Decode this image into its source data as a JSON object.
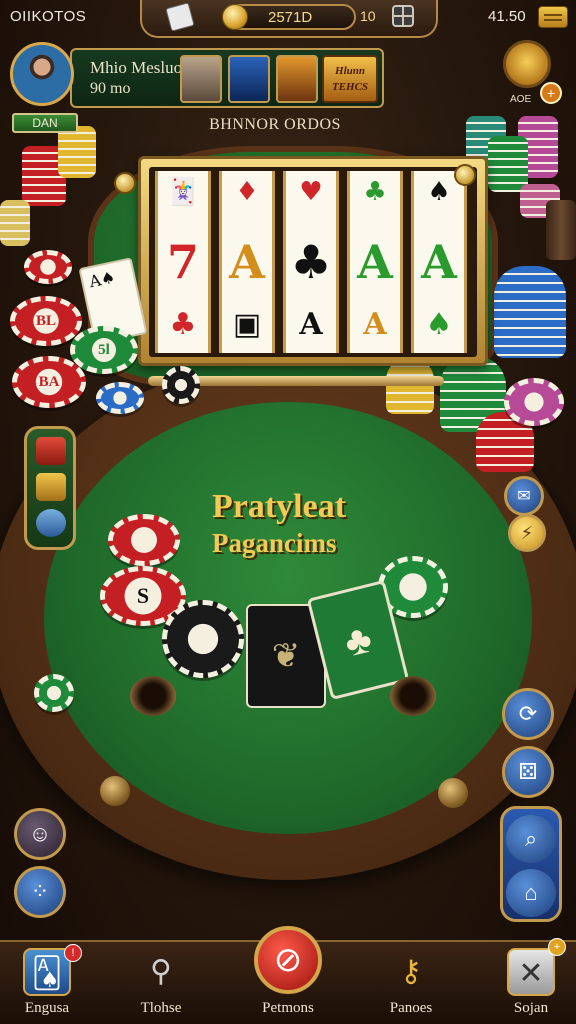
{
  "top_bar": {
    "left_label": "OIIKOTOS",
    "coin_balance": "2571D",
    "level": "10",
    "right_value": "41.50"
  },
  "profile": {
    "name": "Mhio Mesluo",
    "level": "90 mo",
    "status_tag": "DAN",
    "promo_text": "Hlunn TEHCS"
  },
  "table": {
    "title": "BHNNOR ORDOS",
    "felt_title_line1": "Pratyleat",
    "felt_title_line2": "Pagancims"
  },
  "bonus": {
    "label": "AOE",
    "badge": "+"
  },
  "chips": {
    "left_top": "BL",
    "left_green": "5l",
    "left_bottom": "BA",
    "felt_white": "S"
  },
  "slot_machine": {
    "reels": [
      {
        "top": "🃏",
        "mid": "7",
        "bot": "♣"
      },
      {
        "top": "♦",
        "mid": "A",
        "bot": "▣"
      },
      {
        "top": "♥",
        "mid": "♣",
        "bot": "A"
      },
      {
        "top": "♣",
        "mid": "A",
        "bot": "A"
      },
      {
        "top": "♠",
        "mid": "A",
        "bot": "♠"
      }
    ],
    "colors": [
      "#d0262a",
      "#d48c1a",
      "#111111",
      "#2a9a2c",
      "#111111"
    ]
  },
  "bottom_nav": [
    {
      "label": "Engusa",
      "icon": "cards-icon",
      "badge": "!"
    },
    {
      "label": "Tlohse",
      "icon": "search-icon"
    },
    {
      "label": "Petmons",
      "icon": "cancel-icon"
    },
    {
      "label": "Panoes",
      "icon": "key-icon"
    },
    {
      "label": "Sojan",
      "icon": "close-icon",
      "badge": "+"
    }
  ],
  "colors": {
    "felt": "#1f6a2a",
    "rail": "#4a2a13",
    "gold": "#c29a4d"
  }
}
